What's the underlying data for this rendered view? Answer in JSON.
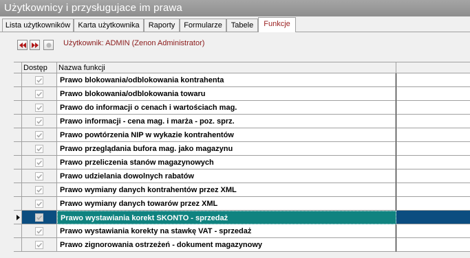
{
  "window": {
    "title": "Użytkownicy i przysługujace im prawa"
  },
  "tabs": [
    {
      "label": "Lista użytkowników",
      "active": false
    },
    {
      "label": "Karta użytkownika",
      "active": false
    },
    {
      "label": "Raporty",
      "active": false
    },
    {
      "label": "Formularze",
      "active": false
    },
    {
      "label": "Tabele",
      "active": false
    },
    {
      "label": "Funkcje",
      "active": true
    }
  ],
  "toolbar": {
    "user_label": "Użytkownik: ADMIN  (Zenon Administrator)",
    "buttons": [
      "first-icon",
      "last-icon",
      "stop-icon"
    ],
    "accent": "#b01818"
  },
  "grid": {
    "headers": {
      "dostep": "Dostęp",
      "nazwa": "Nazwa funkcji"
    },
    "selected_color": "#0b4d80",
    "rows": [
      {
        "label": "Prawo blokowania/odblokowania kontrahenta",
        "checked": true
      },
      {
        "label": "Prawo blokowania/odblokowania towaru",
        "checked": true
      },
      {
        "label": "Prawo do informacji o cenach i wartościach mag.",
        "checked": true
      },
      {
        "label": "Prawo informacji - cena mag. i marża - poz. sprz.",
        "checked": true
      },
      {
        "label": "Prawo powtórzenia NIP w wykazie kontrahentów",
        "checked": true
      },
      {
        "label": "Prawo przeglądania bufora mag. jako magazynu",
        "checked": true
      },
      {
        "label": "Prawo przeliczenia stanów magazynowych",
        "checked": true
      },
      {
        "label": "Prawo udzielania dowolnych rabatów",
        "checked": true
      },
      {
        "label": "Prawo wymiany danych kontrahentów przez XML",
        "checked": true
      },
      {
        "label": "Prawo wymiany danych towarów przez XML",
        "checked": true
      },
      {
        "label": "Prawo wystawiania korekt SKONTO - sprzedaż",
        "checked": true,
        "selected": true
      },
      {
        "label": "Prawo wystawiania korekty na stawkę VAT - sprzedaż",
        "checked": true
      },
      {
        "label": "Prawo zignorowania ostrzeżeń - dokument magazynowy",
        "checked": true
      }
    ]
  }
}
